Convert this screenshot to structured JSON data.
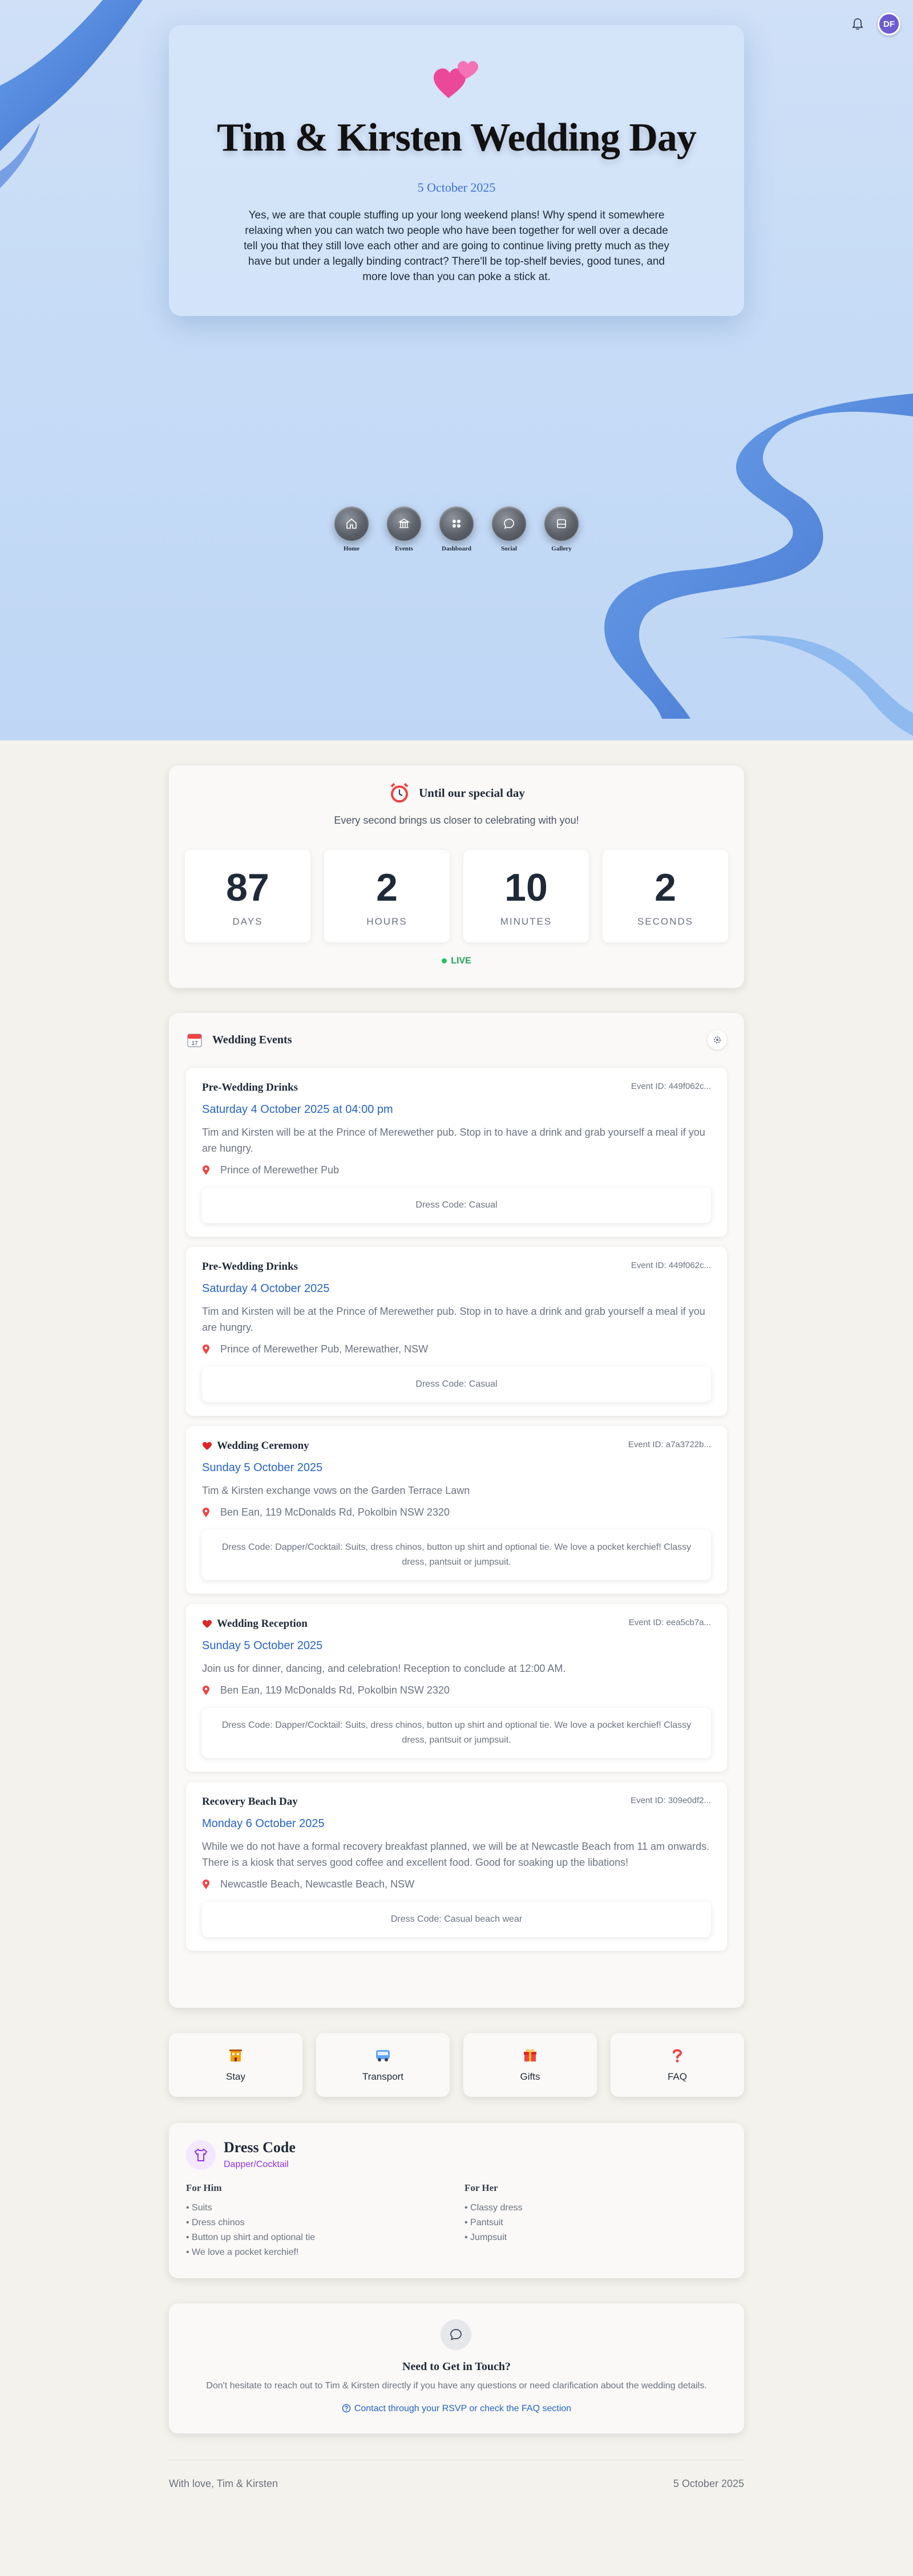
{
  "header": {
    "avatar_initials": "DF",
    "notification_icon": "bell-icon"
  },
  "hero": {
    "title": "Tim & Kirsten Wedding Day",
    "date": "5 October 2025",
    "description": "Yes, we are that couple stuffing up your long weekend plans! Why spend it somewhere relaxing when you can watch two people who have been together for well over a decade tell you that they still love each other and are going to continue living pretty much as they have but under a legally binding contract? There'll be top-shelf bevies, good tunes, and more love than you can poke a stick at.",
    "accent_color": "#3b6fd8"
  },
  "nav": {
    "items": [
      {
        "label": "Home",
        "icon": "home-icon"
      },
      {
        "label": "Events",
        "icon": "bank-icon"
      },
      {
        "label": "Dashboard",
        "icon": "dashboard-icon"
      },
      {
        "label": "Social",
        "icon": "chat-icon"
      },
      {
        "label": "Gallery",
        "icon": "gallery-icon"
      }
    ]
  },
  "countdown": {
    "title": "Until our special day",
    "subtitle": "Every second brings us closer to celebrating with you!",
    "units": [
      {
        "value": "87",
        "label": "DAYS"
      },
      {
        "value": "2",
        "label": "HOURS"
      },
      {
        "value": "10",
        "label": "MINUTES"
      },
      {
        "value": "2",
        "label": "SECONDS"
      }
    ],
    "live_label": "LIVE"
  },
  "events": {
    "title": "Wedding Events",
    "items": [
      {
        "title": "Pre-Wedding Drinks",
        "heart": false,
        "id": "Event ID: 449f062c...",
        "date": "Saturday 4 October 2025 at 04:00 pm",
        "description": "Tim and Kirsten will be at the Prince of Merewether pub. Stop in to have a drink and grab yourself a meal if you are hungry.",
        "location": "Prince of Merewether Pub",
        "dress": "Dress Code: Casual"
      },
      {
        "title": "Pre-Wedding Drinks",
        "heart": false,
        "id": "Event ID: 449f062c...",
        "date": "Saturday 4 October 2025",
        "description": "Tim and Kirsten will be at the Prince of Merewether pub. Stop in to have a drink and grab yourself a meal if you are hungry.",
        "location": "Prince of Merewether Pub, Merewather, NSW",
        "dress": "Dress Code: Casual"
      },
      {
        "title": "Wedding Ceremony",
        "heart": true,
        "id": "Event ID: a7a3722b...",
        "date": "Sunday 5 October 2025",
        "description": "Tim & Kirsten exchange vows on the Garden Terrace Lawn",
        "location": "Ben Ean, 119 McDonalds Rd, Pokolbin NSW 2320",
        "dress": "Dress Code: Dapper/Cocktail: Suits, dress chinos, button up shirt and optional tie. We love a pocket kerchief! Classy dress, pantsuit or jumpsuit."
      },
      {
        "title": "Wedding Reception",
        "heart": true,
        "id": "Event ID: eea5cb7a...",
        "date": "Sunday 5 October 2025",
        "description": "Join us for dinner, dancing, and celebration! Reception to conclude at 12:00 AM.",
        "location": "Ben Ean, 119 McDonalds Rd, Pokolbin NSW 2320",
        "dress": "Dress Code: Dapper/Cocktail: Suits, dress chinos, button up shirt and optional tie. We love a pocket kerchief! Classy dress, pantsuit or jumpsuit."
      },
      {
        "title": "Recovery Beach Day",
        "heart": false,
        "id": "Event ID: 309e0df2...",
        "date": "Monday 6 October 2025",
        "description": "While we do not have a formal recovery breakfast planned, we will be at Newcastle Beach from 11 am onwards. There is a kiosk that serves good coffee and excellent food. Good for soaking up the libations!",
        "location": "Newcastle Beach, Newcastle Beach, NSW",
        "dress": "Dress Code: Casual beach wear"
      }
    ]
  },
  "quick_links": [
    {
      "label": "Stay",
      "icon": "hotel-icon"
    },
    {
      "label": "Transport",
      "icon": "bus-icon"
    },
    {
      "label": "Gifts",
      "icon": "gift-icon"
    },
    {
      "label": "FAQ",
      "icon": "question-icon"
    }
  ],
  "dress_code": {
    "title": "Dress Code",
    "subtitle": "Dapper/Cocktail",
    "him_title": "For Him",
    "him": [
      "Suits",
      "Dress chinos",
      "Button up shirt and optional tie",
      "We love a pocket kerchief!"
    ],
    "her_title": "For Her",
    "her": [
      "Classy dress",
      "Pantsuit",
      "Jumpsuit"
    ]
  },
  "contact": {
    "title": "Need to Get in Touch?",
    "text": "Don't hesitate to reach out to Tim & Kirsten directly if you have any questions or need clarification about the wedding details.",
    "link": "Contact through your RSVP or check the FAQ section"
  },
  "footer": {
    "left": "With love, Tim & Kirsten",
    "right": "5 October 2025"
  }
}
